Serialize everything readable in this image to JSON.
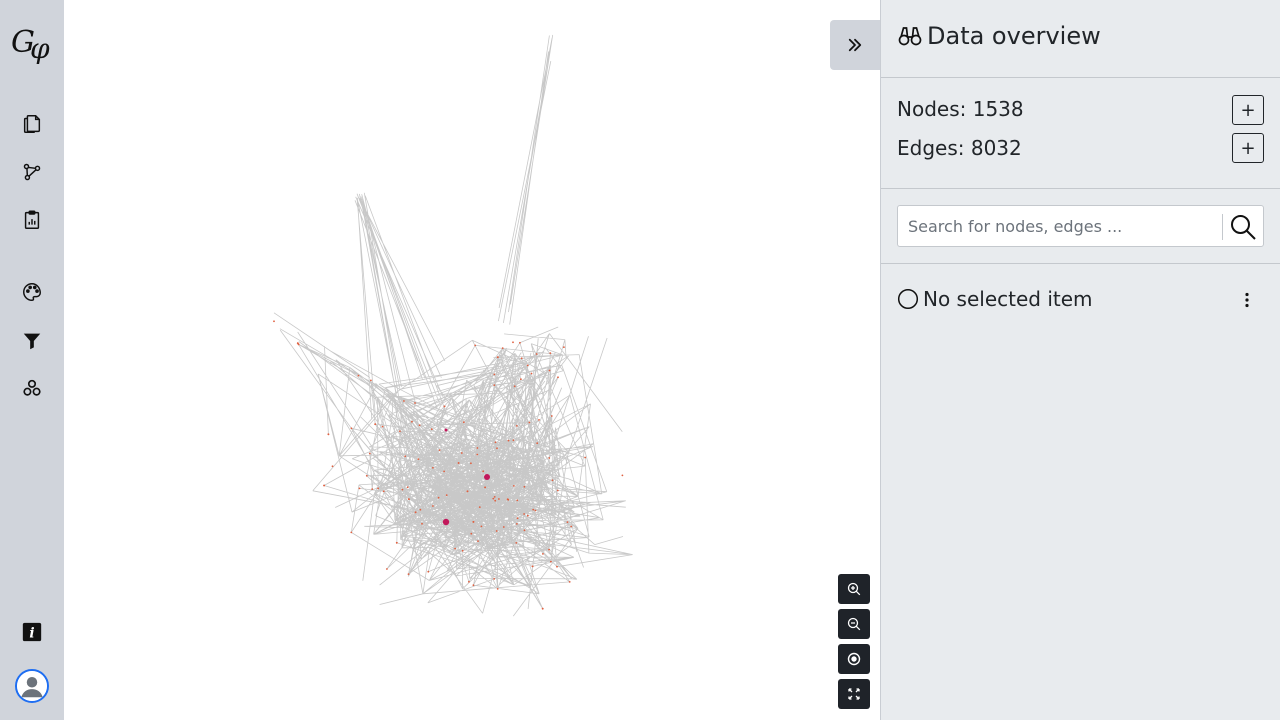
{
  "app": {
    "logo_text": "Gφ"
  },
  "sidebar": {
    "items": [
      {
        "name": "file",
        "icon": "files-icon"
      },
      {
        "name": "graph",
        "icon": "graph-icon"
      },
      {
        "name": "statistics",
        "icon": "clipboard-icon"
      },
      {
        "name": "appearance",
        "icon": "palette-icon"
      },
      {
        "name": "filters",
        "icon": "filter-icon"
      },
      {
        "name": "layouts",
        "icon": "circles-icon"
      }
    ],
    "bottom": [
      {
        "name": "info",
        "icon": "info-icon"
      },
      {
        "name": "user",
        "icon": "user-icon"
      }
    ]
  },
  "panel": {
    "title": "Data overview",
    "nodes_label": "Nodes: 1538",
    "edges_label": "Edges: 8032",
    "add_label": "+",
    "search": {
      "placeholder": "Search for nodes, edges ..."
    },
    "selection": "No selected item"
  },
  "graph": {
    "node_count": 1538,
    "edge_count": 8032
  },
  "colors": {
    "rail": "#d0d4db",
    "panel": "#e8ebee",
    "edge": "#c8c8c8",
    "node": "#e06040",
    "highlight": "#c2185b",
    "zoom_button": "#1f2329",
    "avatar_ring": "#1e6ef2"
  }
}
